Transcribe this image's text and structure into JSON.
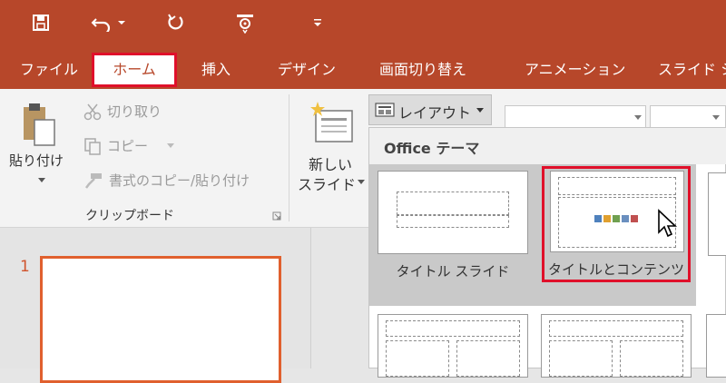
{
  "quick_access": {
    "save": "save-icon",
    "undo": "undo-icon",
    "redo": "redo-icon",
    "present": "present-icon",
    "customize": "customize-icon"
  },
  "tabs": [
    "ファイル",
    "ホーム",
    "挿入",
    "デザイン",
    "画面切り替え",
    "アニメーション",
    "スライド シ"
  ],
  "clipboard": {
    "paste": "貼り付け",
    "cut": "切り取り",
    "copy": "コピー",
    "format_painter": "書式のコピー/貼り付け",
    "group_label": "クリップボード"
  },
  "slides": {
    "new_slide_line1": "新しい",
    "new_slide_line2": "スライド",
    "layout_button": "レイアウト"
  },
  "slide_pane": {
    "slide_number": "1"
  },
  "layout_gallery": {
    "header": "Office テーマ",
    "layouts": [
      "タイトル スライド",
      "タイトルとコンテンツ"
    ]
  },
  "colors": {
    "accent": "#b7472a",
    "highlight": "#e0102a"
  }
}
